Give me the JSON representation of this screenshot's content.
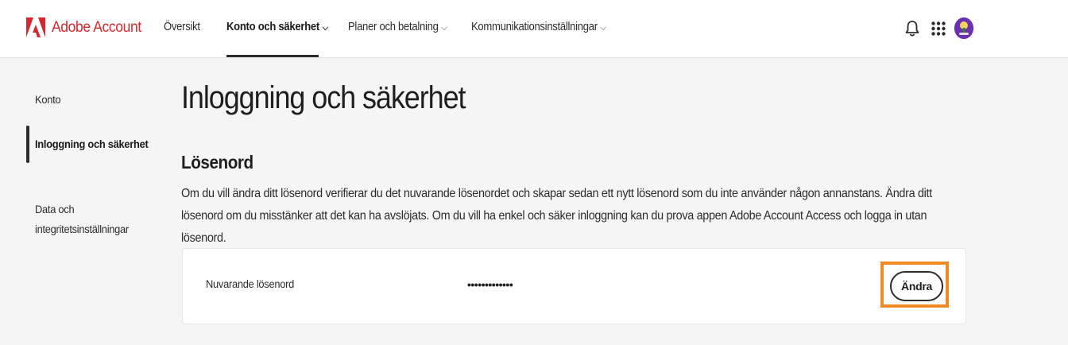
{
  "header": {
    "brand_name": "Adobe Account",
    "nav": [
      {
        "label": "Översikt",
        "has_dropdown": false,
        "active": false
      },
      {
        "label": "Konto och säkerhet",
        "has_dropdown": true,
        "active": true
      },
      {
        "label": "Planer och betalning",
        "has_dropdown": true,
        "active": false
      },
      {
        "label": "Kommunikationsinställningar",
        "has_dropdown": true,
        "active": false
      }
    ],
    "chevron": "⌵",
    "icons": [
      "bell-icon",
      "apps-grid-icon",
      "avatar"
    ]
  },
  "sidebar": {
    "items": [
      {
        "label": "Konto",
        "active": false
      },
      {
        "label": "Inloggning och säkerhet",
        "active": true
      },
      {
        "label": "Data och\nintegritetsinställningar",
        "active": false
      }
    ]
  },
  "main": {
    "title": "Inloggning och säkerhet",
    "password_section": {
      "title": "Lösenord",
      "description": "Om du vill ändra ditt lösenord verifierar du det nuvarande lösenordet och skapar sedan ett nytt lösenord som du inte använder någon annanstans. Ändra ditt lösenord om du misstänker att det kan ha avslöjats. Om du vill ha enkel och säker inloggning kan du prova appen Adobe Account Access och logga in utan lösenord.",
      "row": {
        "label": "Nuvarande lösenord",
        "value": "•••••••••••••",
        "button_label": "Ändra"
      }
    }
  },
  "colors": {
    "brand_red": "#d7262c",
    "highlight_orange": "#f08a24",
    "avatar_purple": "#6b2fb0"
  }
}
